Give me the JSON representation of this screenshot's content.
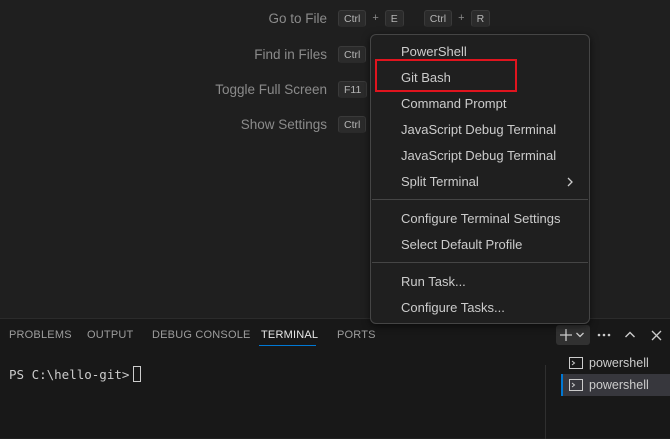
{
  "editor_hints": [
    {
      "label": "Go to File",
      "keys": [
        [
          "Ctrl",
          "E"
        ],
        [
          "Ctrl",
          "R"
        ]
      ]
    },
    {
      "label": "Find in Files",
      "keys": [
        [
          "Ctrl"
        ]
      ]
    },
    {
      "label": "Toggle Full Screen",
      "keys": [
        [
          "F11"
        ]
      ]
    },
    {
      "label": "Show Settings",
      "keys": [
        [
          "Ctrl"
        ]
      ]
    }
  ],
  "key_plus": "+",
  "menu": {
    "items": [
      {
        "label": "PowerShell"
      },
      {
        "label": "Git Bash",
        "highlighted": true
      },
      {
        "label": "Command Prompt"
      },
      {
        "label": "JavaScript Debug Terminal"
      },
      {
        "label": "JavaScript Debug Terminal"
      },
      {
        "label": "Split Terminal",
        "submenu": true
      },
      {
        "label": "Configure Terminal Settings"
      },
      {
        "label": "Select Default Profile"
      },
      {
        "label": "Run Task..."
      },
      {
        "label": "Configure Tasks..."
      }
    ],
    "highlight_color": "#e0141e"
  },
  "panel": {
    "tabs": [
      {
        "label": "PROBLEMS"
      },
      {
        "label": "OUTPUT"
      },
      {
        "label": "DEBUG CONSOLE"
      },
      {
        "label": "TERMINAL",
        "active": true
      },
      {
        "label": "PORTS"
      }
    ],
    "toolbar_icons": [
      "plus-icon",
      "chevron-down-icon",
      "ellipsis-icon",
      "chevron-up-icon",
      "close-icon"
    ],
    "terminal_prompt": "PS C:\\hello-git>",
    "terminals": [
      {
        "label": "powershell",
        "selected": false
      },
      {
        "label": "powershell",
        "selected": true
      }
    ],
    "accent_color": "#0078d4"
  }
}
